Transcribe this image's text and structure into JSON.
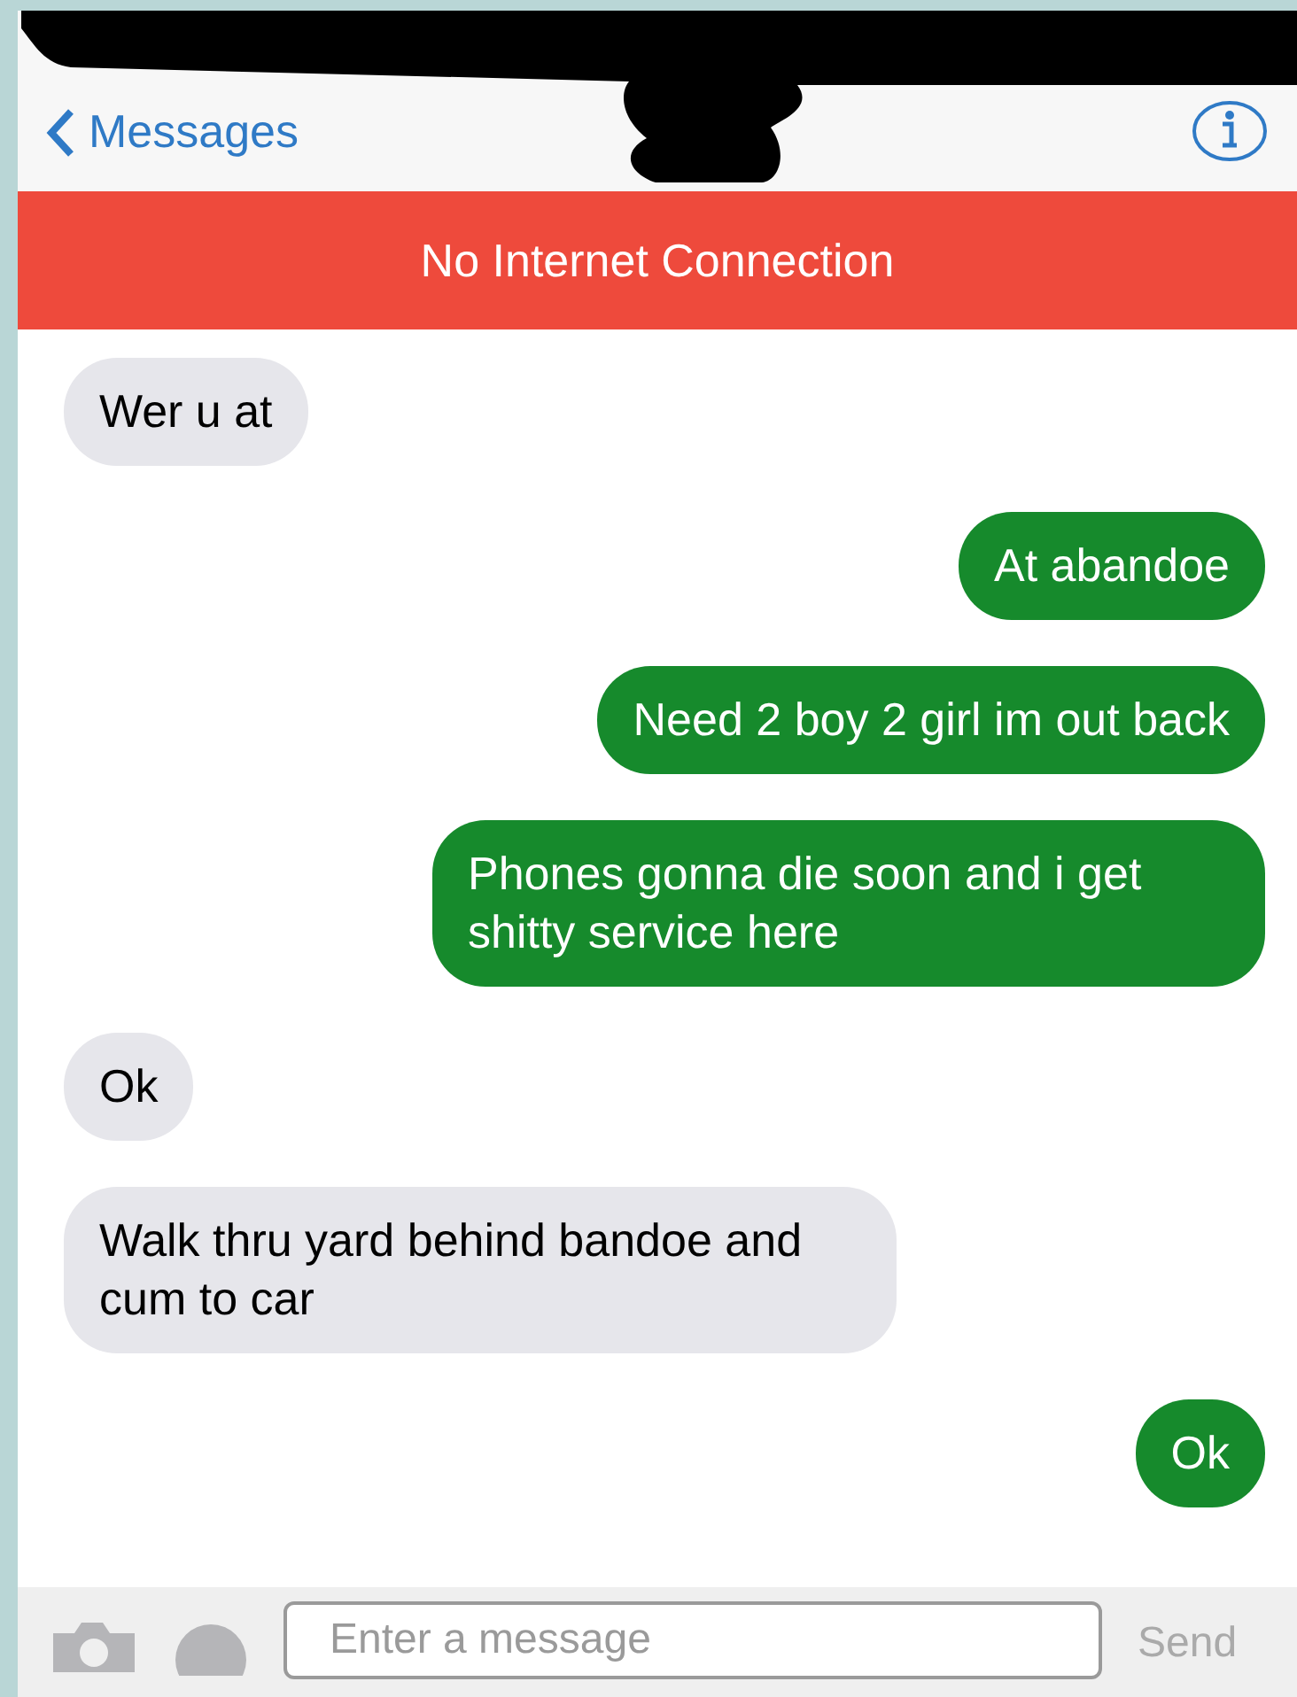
{
  "nav_bar": {
    "back_label": "Messages"
  },
  "banner": {
    "text": "No Internet Connection"
  },
  "messages": [
    {
      "kind": "incoming",
      "text": "Wer u at"
    },
    {
      "kind": "outgoing",
      "text": "At abandoe"
    },
    {
      "kind": "outgoing",
      "text": "Need 2 boy 2 girl im out back"
    },
    {
      "kind": "outgoing",
      "text": "Phones gonna die soon and i get shitty service here"
    },
    {
      "kind": "incoming",
      "text": "Ok"
    },
    {
      "kind": "incoming",
      "text": "Walk thru yard behind bandoe and cum to car"
    },
    {
      "kind": "outgoing",
      "text": "Ok"
    }
  ],
  "composer": {
    "placeholder": "Enter a message",
    "send_label": "Send"
  }
}
